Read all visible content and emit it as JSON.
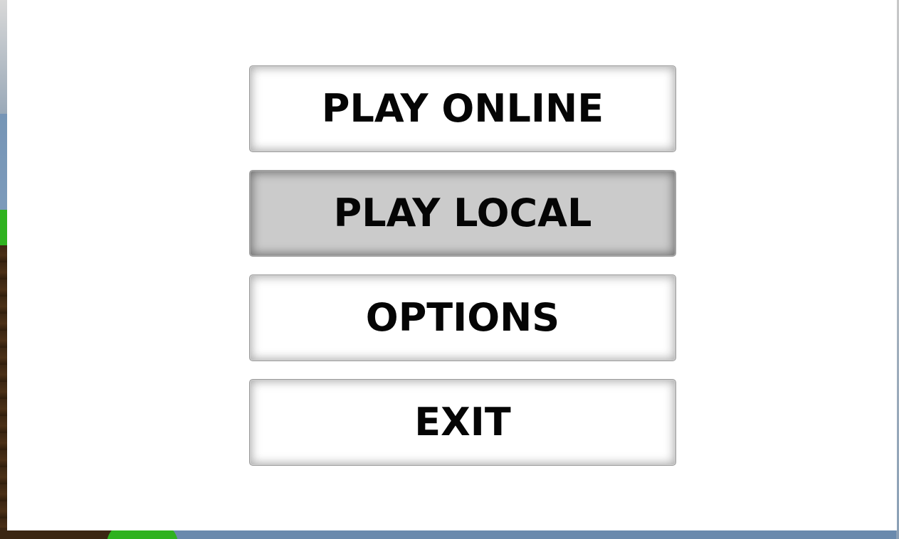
{
  "menu": {
    "items": [
      {
        "label": "PLAY ONLINE",
        "selected": false
      },
      {
        "label": "PLAY LOCAL",
        "selected": true
      },
      {
        "label": "OPTIONS",
        "selected": false
      },
      {
        "label": "EXIT",
        "selected": false
      }
    ]
  },
  "colors": {
    "panel_background": "#ffffff",
    "button_background": "#ffffff",
    "button_selected_background": "#cbcbcb",
    "button_text": "#050505",
    "grass": "#2fb21f",
    "dirt": "#3b2612",
    "sky": "#7e9cbc"
  }
}
